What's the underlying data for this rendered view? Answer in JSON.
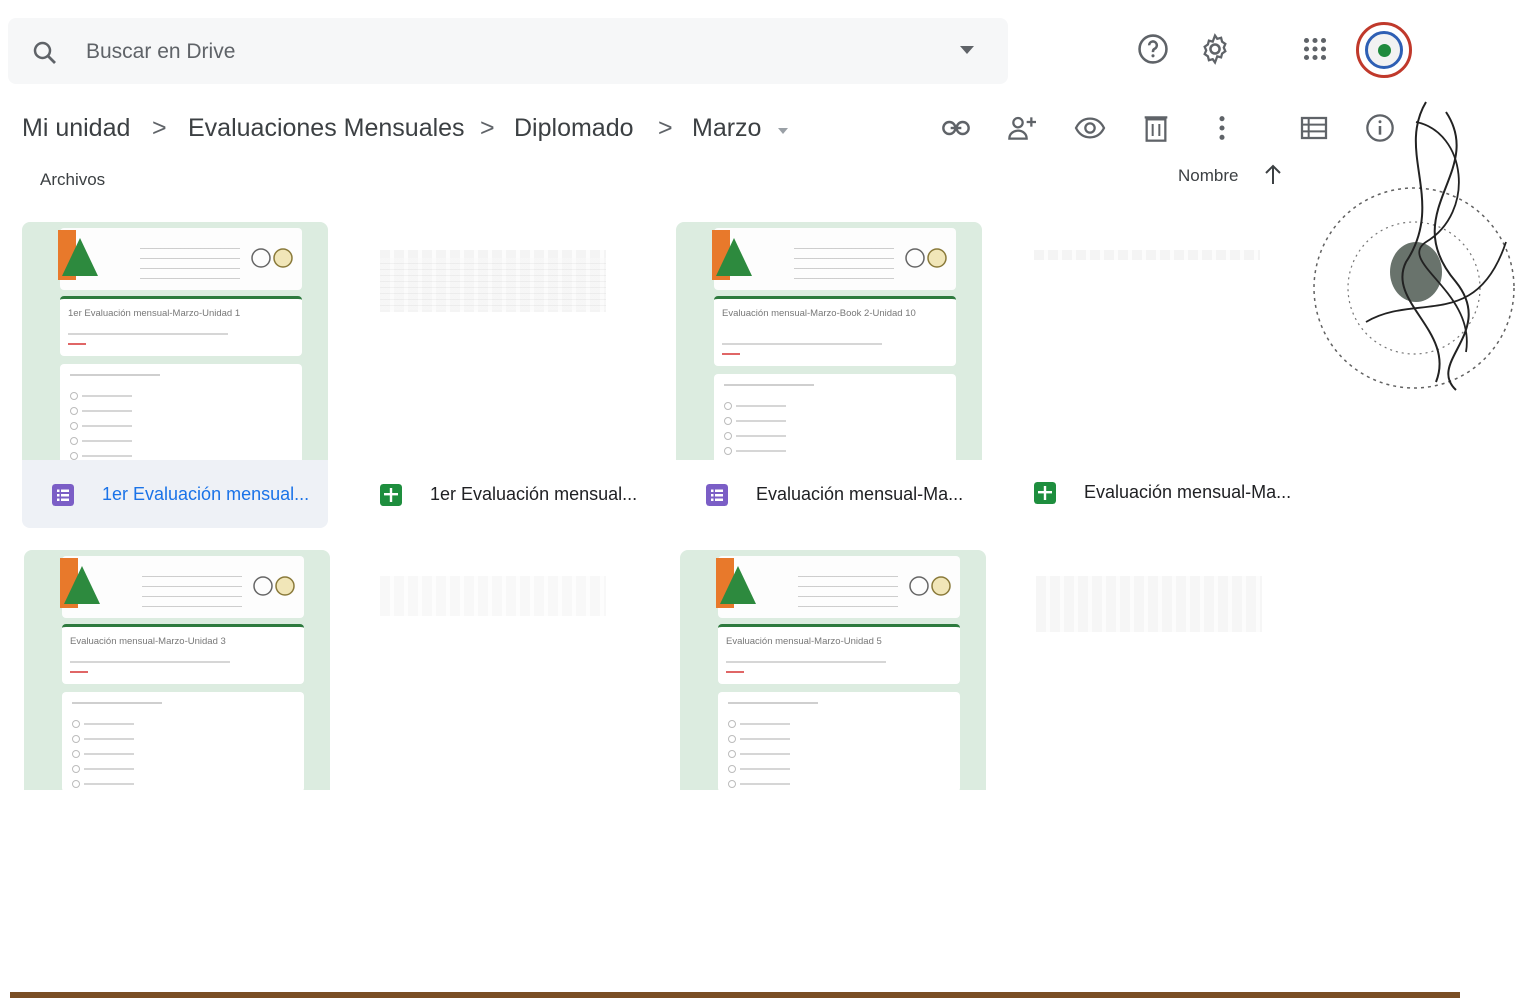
{
  "search": {
    "placeholder": "Buscar en Drive"
  },
  "top_icons": [
    "search-icon",
    "dropdown-icon",
    "help-icon",
    "settings-icon",
    "apps-grid-icon",
    "avatar"
  ],
  "breadcrumb": {
    "items": [
      "Mi unidad",
      "Evaluaciones Mensuales",
      "Diplomado",
      "Marzo"
    ],
    "separator": ">"
  },
  "toolbar_icons": [
    "link-icon",
    "share-icon",
    "preview-icon",
    "trash-icon",
    "more-vert-icon",
    "list-view-icon",
    "info-icon"
  ],
  "section": {
    "label": "Archivos"
  },
  "sort": {
    "label": "Nombre",
    "direction": "ascending"
  },
  "files": [
    {
      "name": "1er Evaluación mensual...",
      "type": "form",
      "selected": true,
      "thumb_title": "1er Evaluación mensual-Marzo-Unidad 1"
    },
    {
      "name": "1er Evaluación mensual...",
      "type": "sheet",
      "selected": false
    },
    {
      "name": "Evaluación mensual-Ma...",
      "type": "form",
      "selected": false,
      "thumb_title": "Evaluación mensual-Marzo-Book 2-Unidad 10"
    },
    {
      "name": "Evaluación mensual-Ma...",
      "type": "sheet",
      "selected": false
    },
    {
      "name": "",
      "type": "form",
      "selected": false,
      "thumb_title": "Evaluación mensual-Marzo-Unidad 3"
    },
    {
      "name": "",
      "type": "sheet",
      "selected": false
    },
    {
      "name": "",
      "type": "form",
      "selected": false,
      "thumb_title": "Evaluación mensual-Marzo-Unidad 5"
    },
    {
      "name": "",
      "type": "sheet",
      "selected": false
    }
  ],
  "colors": {
    "form": "#7b5ec6",
    "sheet": "#1e8e3e",
    "selected_text": "#1a73e8",
    "selected_bg": "#eef1f6",
    "thumb_bg": "#dcece0"
  }
}
